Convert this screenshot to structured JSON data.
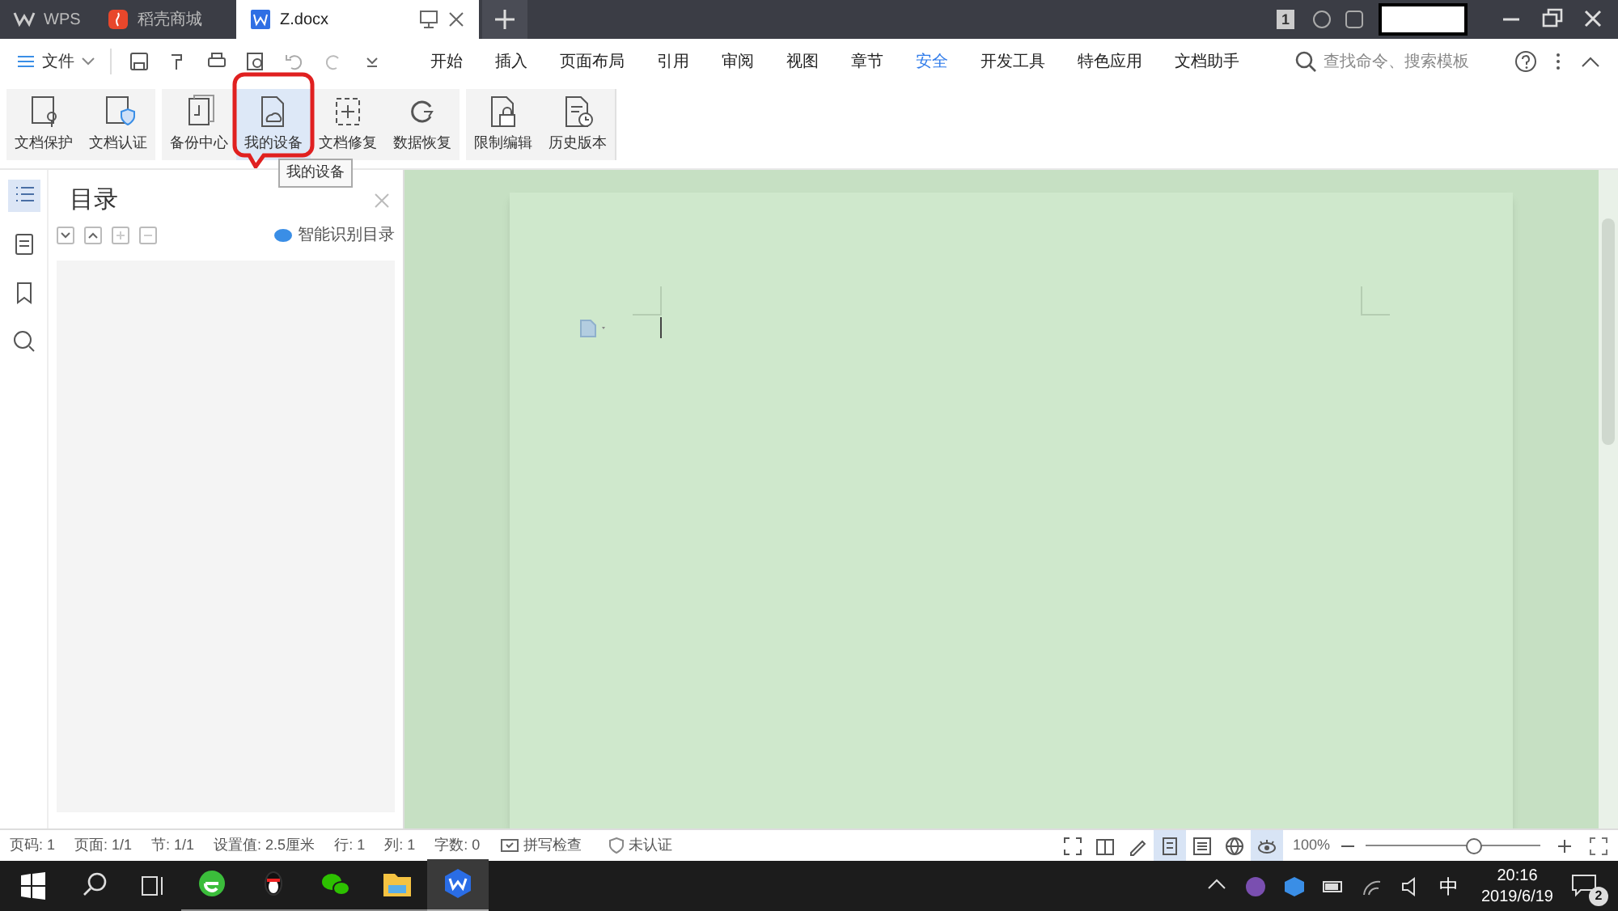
{
  "title_bar": {
    "tabs": [
      {
        "kind": "home",
        "label": "WPS",
        "selected": false
      },
      {
        "kind": "store",
        "label": "稻壳商城",
        "selected": false
      },
      {
        "kind": "doc",
        "label": "Z.docx",
        "selected": true
      }
    ],
    "page_badge": "1"
  },
  "menu": {
    "file_label": "文件",
    "tabs": [
      {
        "label": "开始",
        "selected": false
      },
      {
        "label": "插入",
        "selected": false
      },
      {
        "label": "页面布局",
        "selected": false
      },
      {
        "label": "引用",
        "selected": false
      },
      {
        "label": "审阅",
        "selected": false
      },
      {
        "label": "视图",
        "selected": false
      },
      {
        "label": "章节",
        "selected": false
      },
      {
        "label": "安全",
        "selected": true
      },
      {
        "label": "开发工具",
        "selected": false
      },
      {
        "label": "特色应用",
        "selected": false
      },
      {
        "label": "文档助手",
        "selected": false
      }
    ],
    "search": {
      "placeholder": "查找命令、搜索模板"
    }
  },
  "ribbon": {
    "groups": [
      [
        {
          "label": "文档保护",
          "selected": false
        },
        {
          "label": "文档认证",
          "selected": false
        }
      ],
      [
        {
          "label": "备份中心",
          "selected": false
        },
        {
          "label": "我的设备",
          "selected": true
        },
        {
          "label": "文档修复",
          "selected": false
        },
        {
          "label": "数据恢复",
          "selected": false
        }
      ],
      [
        {
          "label": "限制编辑",
          "selected": false
        },
        {
          "label": "历史版本",
          "selected": false
        }
      ]
    ],
    "tooltip": "我的设备"
  },
  "side_tools": [
    {
      "selected": true
    },
    {
      "selected": false
    },
    {
      "selected": false
    },
    {
      "selected": false
    }
  ],
  "toc_panel": {
    "title": "目录",
    "smart_button": "智能识别目录"
  },
  "status_bar": {
    "items": [
      "页码: 1",
      "页面: 1/1",
      "节: 1/1",
      "设置值: 2.5厘米",
      "行: 1",
      "列: 1",
      "字数: 0"
    ],
    "spell_check": "拼写检查",
    "certification": "未认证",
    "views": [
      {
        "selected": false
      },
      {
        "selected": false
      },
      {
        "selected": false
      },
      {
        "selected": true
      },
      {
        "selected": false
      },
      {
        "selected": false
      },
      {
        "selected": true
      }
    ],
    "zoom": "100%",
    "zoom_slider": {
      "level": 0.62
    }
  },
  "taskbar": {
    "apps": [
      {
        "selected": false
      },
      {
        "selected": false
      },
      {
        "selected": false
      },
      {
        "selected": false
      },
      {
        "selected": true
      }
    ],
    "ime": "中",
    "time": "20:16",
    "date": "2019/6/19",
    "notifications": "2"
  }
}
